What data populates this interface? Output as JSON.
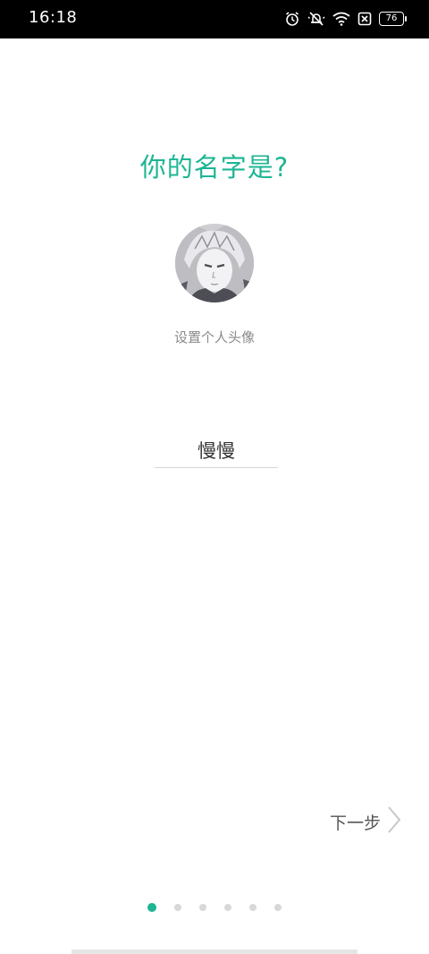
{
  "status_bar": {
    "time": "16:18",
    "battery": "76",
    "icons": [
      "alarm-icon",
      "mute-icon",
      "wifi-icon",
      "sim-off-icon",
      "battery-icon"
    ]
  },
  "page": {
    "title": "你的名字是?",
    "avatar_caption": "设置个人头像",
    "name_value": "慢慢",
    "next_label": "下一步"
  },
  "pager": {
    "total": 6,
    "current": 1
  },
  "colors": {
    "accent": "#1db593",
    "text_dark": "#333333",
    "text_gray": "#8a8a8a"
  }
}
